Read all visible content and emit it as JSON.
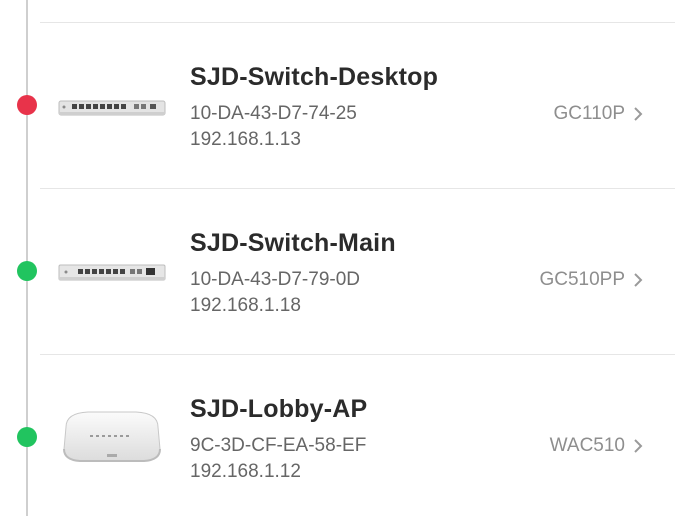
{
  "colors": {
    "offline": "#e8334a",
    "online": "#21c45f",
    "timeline": "#cfcfcf"
  },
  "devices": [
    {
      "name": "SJD-Switch-Desktop",
      "mac": "10-DA-43-D7-74-25",
      "ip": "192.168.1.13",
      "model": "GC110P",
      "status": "offline",
      "icon": "desktop-switch-icon"
    },
    {
      "name": "SJD-Switch-Main",
      "mac": "10-DA-43-D7-79-0D",
      "ip": "192.168.1.18",
      "model": "GC510PP",
      "status": "online",
      "icon": "rack-switch-icon"
    },
    {
      "name": "SJD-Lobby-AP",
      "mac": "9C-3D-CF-EA-58-EF",
      "ip": "192.168.1.12",
      "model": "WAC510",
      "status": "online",
      "icon": "access-point-icon"
    }
  ]
}
